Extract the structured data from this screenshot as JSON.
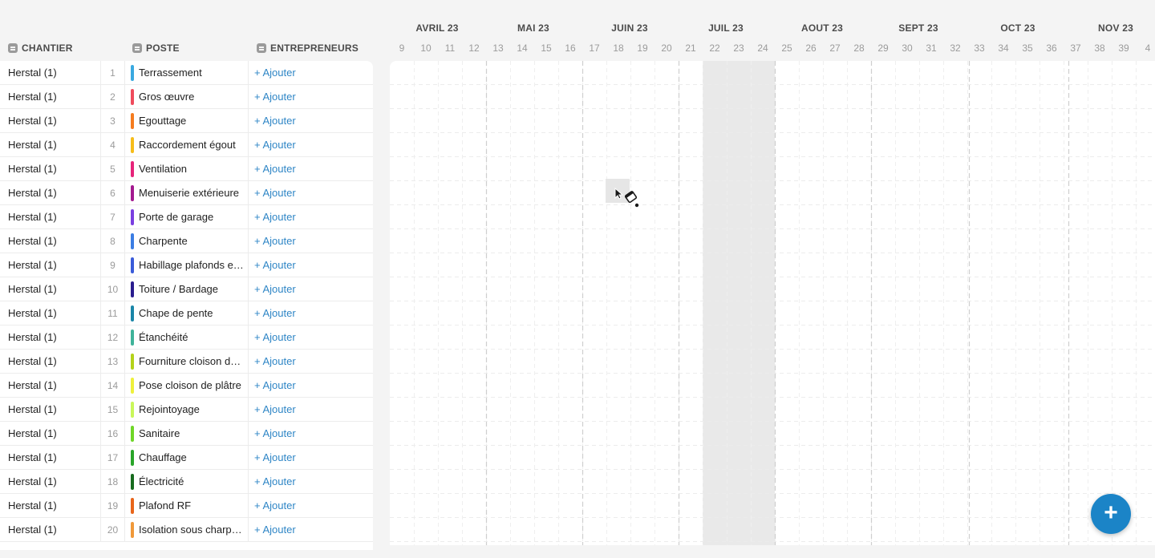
{
  "headers": {
    "chantier": "CHANTIER",
    "poste": "POSTE",
    "entrepreneurs": "ENTREPRENEURS"
  },
  "rows": [
    {
      "chantier": "Herstal (1)",
      "num": "1",
      "poste": "Terrassement",
      "color": "#3aa9e0",
      "action": "+ Ajouter"
    },
    {
      "chantier": "Herstal (1)",
      "num": "2",
      "poste": "Gros œuvre",
      "color": "#ef4b5c",
      "action": "+ Ajouter"
    },
    {
      "chantier": "Herstal (1)",
      "num": "3",
      "poste": "Egouttage",
      "color": "#f57c1f",
      "action": "+ Ajouter"
    },
    {
      "chantier": "Herstal (1)",
      "num": "4",
      "poste": "Raccordement égout",
      "color": "#f6bd1a",
      "action": "+ Ajouter"
    },
    {
      "chantier": "Herstal (1)",
      "num": "5",
      "poste": "Ventilation",
      "color": "#e6247a",
      "action": "+ Ajouter"
    },
    {
      "chantier": "Herstal (1)",
      "num": "6",
      "poste": "Menuiserie extérieure",
      "color": "#a3198f",
      "action": "+ Ajouter"
    },
    {
      "chantier": "Herstal (1)",
      "num": "7",
      "poste": "Porte de garage",
      "color": "#7a3fe0",
      "action": "+ Ajouter"
    },
    {
      "chantier": "Herstal (1)",
      "num": "8",
      "poste": "Charpente",
      "color": "#3b7de3",
      "action": "+ Ajouter"
    },
    {
      "chantier": "Herstal (1)",
      "num": "9",
      "poste": "Habillage plafonds e…",
      "color": "#3a5bd9",
      "action": "+ Ajouter"
    },
    {
      "chantier": "Herstal (1)",
      "num": "10",
      "poste": "Toiture / Bardage",
      "color": "#2a1d8f",
      "action": "+ Ajouter"
    },
    {
      "chantier": "Herstal (1)",
      "num": "11",
      "poste": "Chape de pente",
      "color": "#1a86a8",
      "action": "+ Ajouter"
    },
    {
      "chantier": "Herstal (1)",
      "num": "12",
      "poste": "Étanchéité",
      "color": "#3fb39a",
      "action": "+ Ajouter"
    },
    {
      "chantier": "Herstal (1)",
      "num": "13",
      "poste": "Fourniture cloison d…",
      "color": "#b4d21a",
      "action": "+ Ajouter"
    },
    {
      "chantier": "Herstal (1)",
      "num": "14",
      "poste": "Pose cloison de plâtre",
      "color": "#eef03c",
      "action": "+ Ajouter"
    },
    {
      "chantier": "Herstal (1)",
      "num": "15",
      "poste": "Rejointoyage",
      "color": "#c9f75a",
      "action": "+ Ajouter"
    },
    {
      "chantier": "Herstal (1)",
      "num": "16",
      "poste": "Sanitaire",
      "color": "#6fd628",
      "action": "+ Ajouter"
    },
    {
      "chantier": "Herstal (1)",
      "num": "17",
      "poste": "Chauffage",
      "color": "#2aa52a",
      "action": "+ Ajouter"
    },
    {
      "chantier": "Herstal (1)",
      "num": "18",
      "poste": "Électricité",
      "color": "#176b1e",
      "action": "+ Ajouter"
    },
    {
      "chantier": "Herstal (1)",
      "num": "19",
      "poste": "Plafond RF",
      "color": "#e8651a",
      "action": "+ Ajouter"
    },
    {
      "chantier": "Herstal (1)",
      "num": "20",
      "poste": "Isolation sous charp…",
      "color": "#f0993a",
      "action": "+ Ajouter"
    }
  ],
  "timeline": {
    "months": [
      "AVRIL 23",
      "MAI 23",
      "JUIN 23",
      "JUIL 23",
      "AOUT 23",
      "SEPT 23",
      "OCT 23",
      "NOV 23"
    ],
    "weeks": [
      "9",
      "10",
      "11",
      "12",
      "13",
      "14",
      "15",
      "16",
      "17",
      "18",
      "19",
      "20",
      "21",
      "22",
      "23",
      "24",
      "25",
      "26",
      "27",
      "28",
      "29",
      "30",
      "31",
      "32",
      "33",
      "34",
      "35",
      "36",
      "37",
      "38",
      "39",
      "4"
    ],
    "holiday_weeks": [
      "22",
      "23",
      "24"
    ]
  },
  "fab_label": "+"
}
